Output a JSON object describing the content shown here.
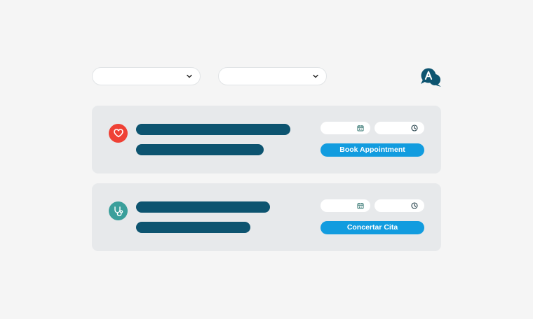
{
  "colors": {
    "background": "#f5f5f5",
    "card": "#e7e9eb",
    "bar": "#0d5470",
    "accent_button": "#129cdf",
    "heart_badge": "#ef4135",
    "health_badge": "#3a9f9b",
    "icon_dark": "#0d5470"
  },
  "filters": {
    "first": {
      "value": "",
      "icon": "chevron-down-icon"
    },
    "second": {
      "value": "",
      "icon": "chevron-down-icon"
    }
  },
  "translate": {
    "icon": "translate-chat-icon"
  },
  "cards": [
    {
      "icon": "heart-icon",
      "date": {
        "value": "",
        "icon": "calendar-icon"
      },
      "time": {
        "value": "",
        "icon": "clock-icon"
      },
      "button_label": "Book Appointment"
    },
    {
      "icon": "stethoscope-icon",
      "date": {
        "value": "",
        "icon": "calendar-icon"
      },
      "time": {
        "value": "",
        "icon": "clock-icon"
      },
      "button_label": "Concertar Cita"
    }
  ]
}
